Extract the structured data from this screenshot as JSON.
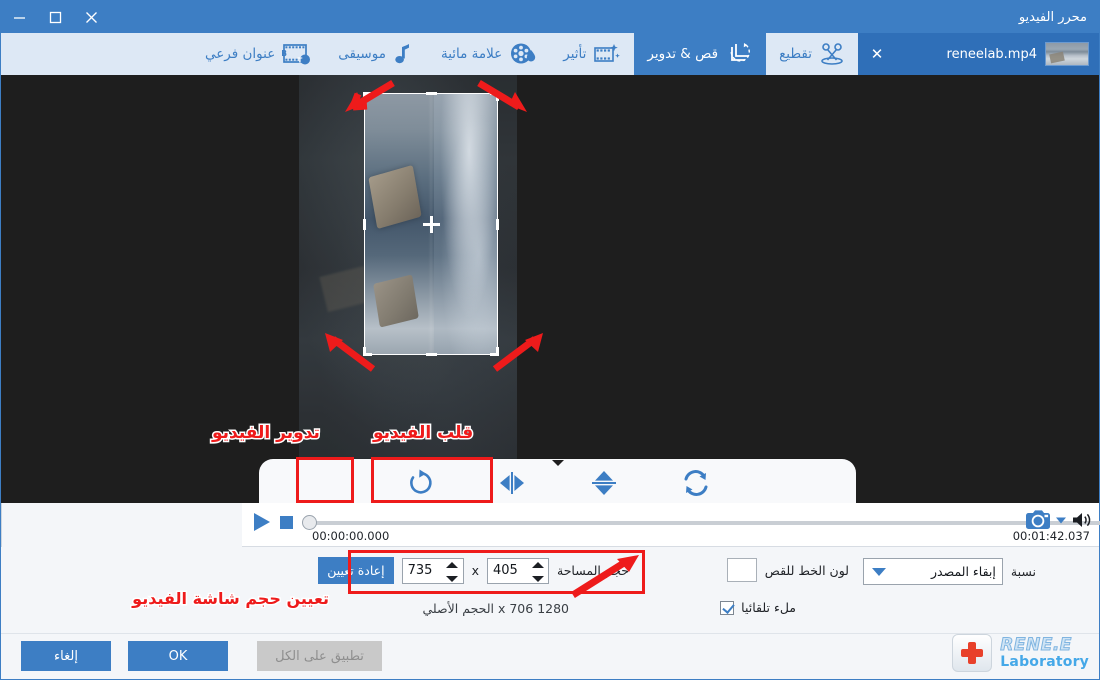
{
  "window": {
    "title": "محرر الفيديو",
    "minimize_label": "—",
    "maximize_label": "□",
    "close_label": "✕"
  },
  "file_tab": {
    "name": "reneelab.mp4",
    "close_label": "✕"
  },
  "toolbar": {
    "items": [
      {
        "label": "تقطيع",
        "icon": "scissors-icon",
        "active": false
      },
      {
        "label": "قص & تدوير",
        "icon": "crop-rotate-icon",
        "active": true
      },
      {
        "label": "تأثير",
        "icon": "effect-film-icon",
        "active": false
      },
      {
        "label": "علامة مائية",
        "icon": "watermark-icon",
        "active": false
      },
      {
        "label": "موسيقى",
        "icon": "music-note-icon",
        "active": false
      },
      {
        "label": "عنوان فرعي",
        "icon": "subtitle-icon",
        "active": false
      }
    ]
  },
  "annotations": {
    "flip_video": "قلب الفيديو",
    "rotate_video": "تدوير الفيديو",
    "set_screen_size": "تعيين حجم شاشة الفيديو"
  },
  "stage_tools": {
    "rotate": "rotate-right-icon",
    "flip_horizontal": "flip-horizontal-icon",
    "flip_vertical": "flip-vertical-icon",
    "reset": "reset-swap-icon"
  },
  "player": {
    "play_icon": "play-icon",
    "stop_icon": "stop-icon",
    "current_time": "00:00:00.000",
    "total_time": "00:01:42.037",
    "snapshot_icon": "camera-icon",
    "snapshot_dropdown_icon": "chevron-down-icon",
    "volume_icon": "volume-icon"
  },
  "settings": {
    "area_size_label": "حجم المساحة",
    "width_value": "405",
    "separator": "x",
    "height_value": "735",
    "reset_button": "إعادة تعيين",
    "original_size_text": "1280 x 706 الحجم الأصلي",
    "crop_line_color_label": "لون الخط للقص",
    "crop_line_color_value": "#ffffff",
    "auto_fill_label": "ملء تلقائيا",
    "auto_fill_checked": true,
    "ratio_label": "نسبة",
    "ratio_value": "إبقاء المصدر"
  },
  "footer": {
    "logo_line1": "RENE.E",
    "logo_line2": "Laboratory",
    "apply_all": "تطبيق على الكل",
    "ok": "OK",
    "cancel": "إلغاء"
  },
  "colors": {
    "accent": "#3d7ec4",
    "tab_active": "#2f6fb8",
    "toolbar_bg": "#dde8f5",
    "annotation_red": "#ee1b1b",
    "stage_bg": "#1e1e1e"
  }
}
